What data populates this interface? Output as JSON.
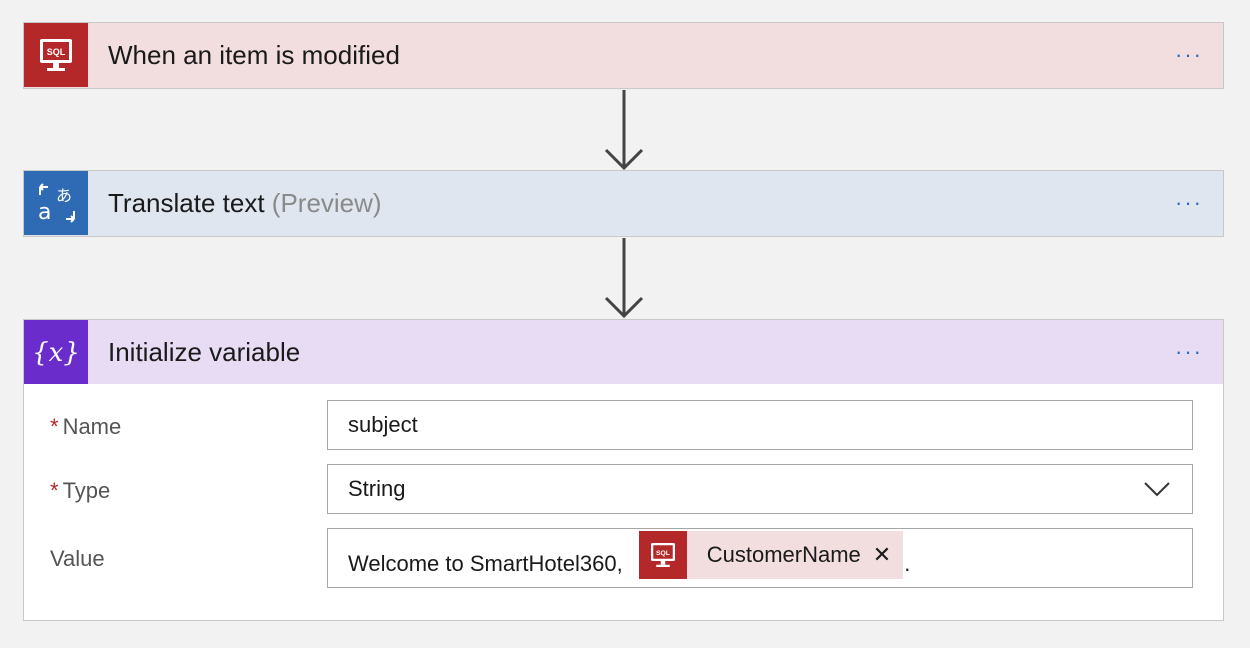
{
  "steps": [
    {
      "title": "When an item is modified",
      "subtitle": "",
      "icon": "sql-server-icon",
      "color": "#b5282a",
      "more_label": "···"
    },
    {
      "title": "Translate text",
      "subtitle": "(Preview)",
      "icon": "translator-icon",
      "color": "#2f6bb4",
      "more_label": "···"
    },
    {
      "title": "Initialize variable",
      "subtitle": "",
      "icon": "variable-icon",
      "color": "#6a2ccb",
      "more_label": "···"
    }
  ],
  "sql_icon_text": "SQL",
  "variable_form": {
    "name": {
      "label": "Name",
      "required_mark": "*",
      "value": "subject"
    },
    "type": {
      "label": "Type",
      "required_mark": "*",
      "value": "String"
    },
    "value": {
      "label": "Value",
      "text_before": "Welcome to SmartHotel360,",
      "token": {
        "label": "CustomerName",
        "close": "✕",
        "icon": "sql-server-icon"
      },
      "text_after": "."
    }
  }
}
